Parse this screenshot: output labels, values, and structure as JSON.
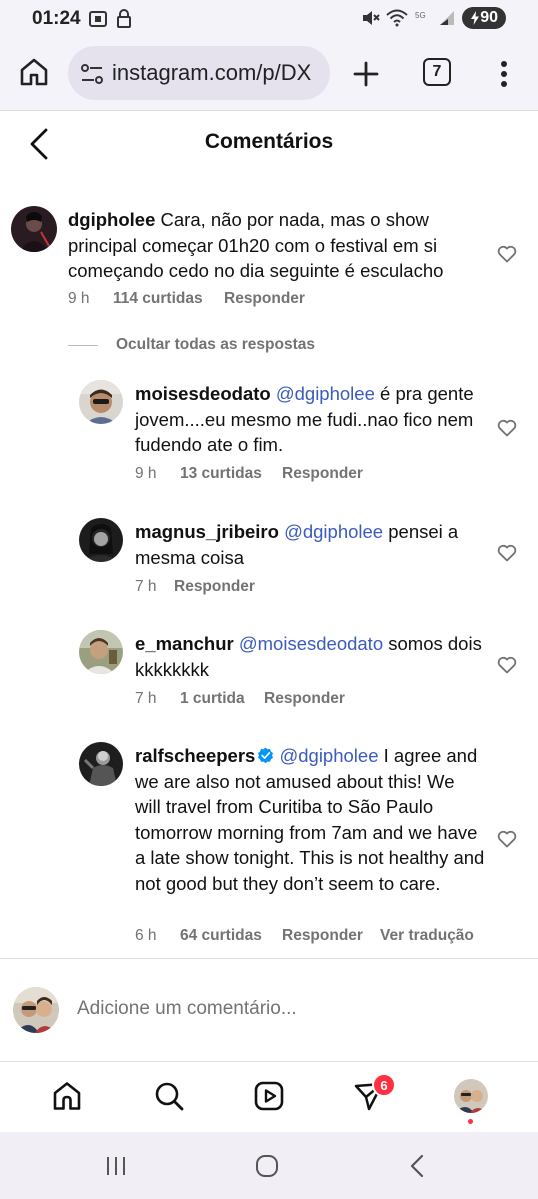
{
  "status_bar": {
    "time": "01:24",
    "battery": "90",
    "icons": [
      "screenshot-icon",
      "lock-icon",
      "mute-icon",
      "wifi-icon",
      "5g-icon",
      "signal-icon"
    ]
  },
  "browser": {
    "url": "instagram.com/p/DX",
    "tab_count": "7"
  },
  "header": {
    "title": "Comentários"
  },
  "comments": [
    {
      "username": "dgipholee",
      "text": "Cara, não por nada, mas o show principal começar 01h20 com o festival em si começando cedo no dia seguinte é esculacho",
      "time": "9 h",
      "likes": "114 curtidas",
      "reply": "Responder"
    }
  ],
  "hide_replies_label": "Ocultar todas as respostas",
  "replies": [
    {
      "username": "moisesdeodato",
      "mention": "@dgipholee",
      "text": "é pra gente jovem....eu mesmo me fudi..nao fico nem fudendo ate o fim.",
      "time": "9 h",
      "likes": "13 curtidas",
      "reply": "Responder"
    },
    {
      "username": "magnus_jribeiro",
      "mention": "@dgipholee",
      "text": "pensei a mesma coisa",
      "time": "7 h",
      "reply": "Responder"
    },
    {
      "username": "e_manchur",
      "mention": "@moisesdeodato",
      "text": "somos dois kkkkkkkk",
      "time": "7 h",
      "likes": "1 curtida",
      "reply": "Responder"
    },
    {
      "username": "ralfscheepers",
      "verified": true,
      "mention": "@dgipholee",
      "text": "I agree and we are also not amused about this! We will travel from Curitiba to São Paulo tomorrow morning from 7am and we have a late show tonight. This is not healthy and not good but they don’t seem to care.",
      "time": "6 h",
      "likes": "64 curtidas",
      "reply": "Responder",
      "translate": "Ver tradução"
    }
  ],
  "add_comment": {
    "placeholder": "Adicione um comentário..."
  },
  "bottom_nav": {
    "notification_count": "6"
  },
  "colors": {
    "mention": "#3b5bbd",
    "meta": "#737373",
    "badge": "#ff3040",
    "verified": "#0095f6",
    "chrome_bg": "#f5f3fa"
  }
}
